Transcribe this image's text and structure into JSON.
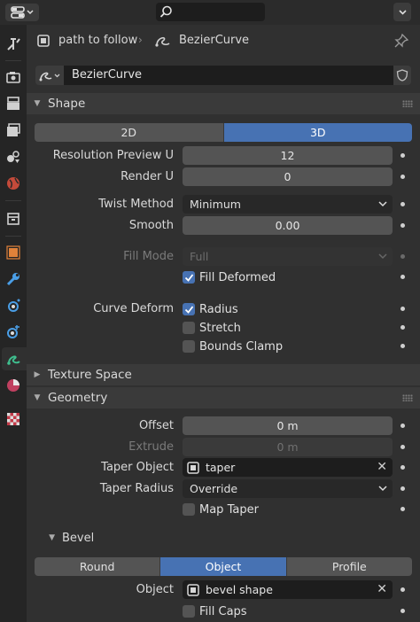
{
  "context": {
    "object_name": "path to follow",
    "data_name": "BezierCurve"
  },
  "datablock": {
    "name": "BezierCurve"
  },
  "shape": {
    "title": "Shape",
    "dimensions": [
      "2D",
      "3D"
    ],
    "active_dimension": "3D",
    "resolution_preview_u": {
      "label": "Resolution Preview U",
      "value": "12"
    },
    "render_u": {
      "label": "Render U",
      "value": "0"
    },
    "twist_method": {
      "label": "Twist Method",
      "value": "Minimum"
    },
    "smooth": {
      "label": "Smooth",
      "value": "0.00"
    },
    "fill_mode": {
      "label": "Fill Mode",
      "value": "Full"
    },
    "fill_deformed": {
      "label": "Fill Deformed",
      "checked": true
    },
    "curve_deform": {
      "label": "Curve Deform",
      "radius": {
        "label": "Radius",
        "checked": true
      },
      "stretch": {
        "label": "Stretch",
        "checked": false
      },
      "bounds_clamp": {
        "label": "Bounds Clamp",
        "checked": false
      }
    }
  },
  "texture_space": {
    "title": "Texture Space"
  },
  "geometry": {
    "title": "Geometry",
    "offset": {
      "label": "Offset",
      "value": "0 m"
    },
    "extrude": {
      "label": "Extrude",
      "value": "0 m"
    },
    "taper_object": {
      "label": "Taper Object",
      "value": "taper"
    },
    "taper_radius": {
      "label": "Taper Radius",
      "value": "Override"
    },
    "map_taper": {
      "label": "Map Taper",
      "checked": false
    }
  },
  "bevel": {
    "title": "Bevel",
    "modes": [
      "Round",
      "Object",
      "Profile"
    ],
    "active_mode": "Object",
    "object": {
      "label": "Object",
      "value": "bevel shape"
    },
    "fill_caps": {
      "label": "Fill Caps",
      "checked": false
    }
  },
  "colors": {
    "accent": "#4772b3",
    "panel_bg": "#303030",
    "header_bg": "#3a3a3a",
    "field_bg": "#545454",
    "curve_tab_icon": "#3fbf8f"
  },
  "icons": {
    "editor_type": "properties-editor-icon",
    "search": "search-icon",
    "pin": "pin-icon",
    "curve_data": "curve-data-icon",
    "fake_user": "shield-icon"
  }
}
